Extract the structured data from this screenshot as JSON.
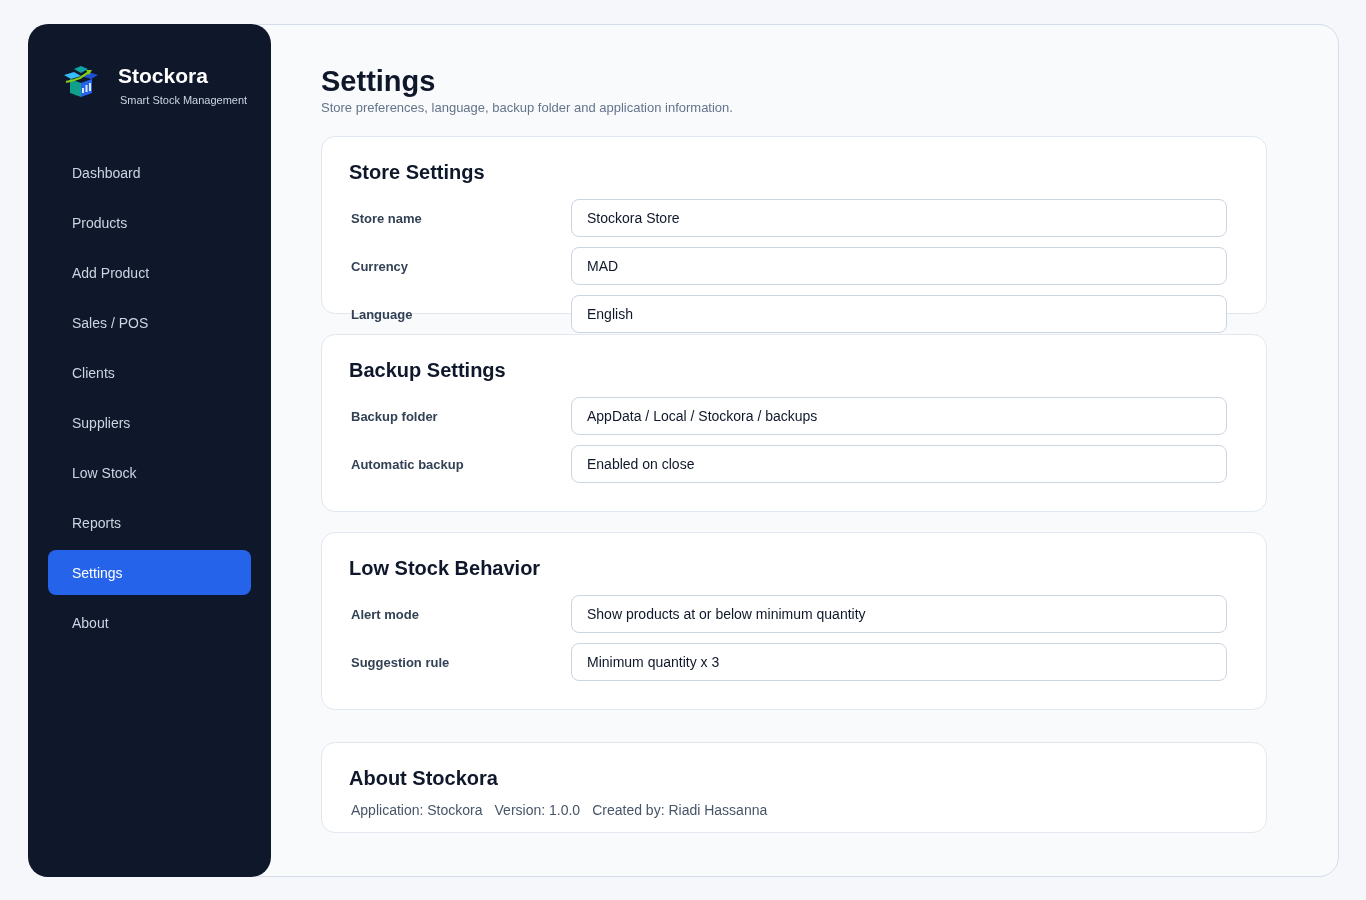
{
  "sidebar": {
    "brand": {
      "name": "Stockora",
      "tagline": "Smart Stock Management"
    },
    "items": [
      {
        "label": "Dashboard",
        "selected": false
      },
      {
        "label": "Products",
        "selected": false
      },
      {
        "label": "Add Product",
        "selected": false
      },
      {
        "label": "Sales / POS",
        "selected": false
      },
      {
        "label": "Clients",
        "selected": false
      },
      {
        "label": "Suppliers",
        "selected": false
      },
      {
        "label": "Low Stock",
        "selected": false
      },
      {
        "label": "Reports",
        "selected": false
      },
      {
        "label": "Settings",
        "selected": true
      },
      {
        "label": "About",
        "selected": false
      }
    ]
  },
  "header": {
    "title": "Settings",
    "subtitle": "Store preferences, language, backup folder and application information."
  },
  "sections": [
    {
      "title": "Store Settings",
      "fields": [
        {
          "label": "Store name",
          "value": "Stockora Store"
        },
        {
          "label": "Currency",
          "value": "MAD"
        },
        {
          "label": "Language",
          "value": "English"
        }
      ]
    },
    {
      "title": "Backup Settings",
      "fields": [
        {
          "label": "Backup folder",
          "value": "AppData / Local / Stockora / backups"
        },
        {
          "label": "Automatic backup",
          "value": "Enabled on close"
        }
      ]
    },
    {
      "title": "Low Stock Behavior",
      "fields": [
        {
          "label": "Alert mode",
          "value": "Show products at or below minimum quantity"
        },
        {
          "label": "Suggestion rule",
          "value": "Minimum quantity x 3"
        }
      ]
    }
  ],
  "about": {
    "title": "About Stockora",
    "items": [
      "Application: Stockora",
      "Version: 1.0.0",
      "Created by: Riadi Hassanna"
    ]
  }
}
